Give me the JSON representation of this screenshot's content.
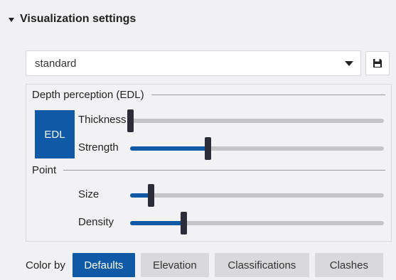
{
  "panel": {
    "title": "Visualization settings"
  },
  "preset": {
    "selected": "standard"
  },
  "edl": {
    "section_title": "Depth perception (EDL)",
    "toggle_label": "EDL",
    "toggle_on": true,
    "thickness": {
      "label": "Thickness",
      "value": 0.0
    },
    "strength": {
      "label": "Strength",
      "value": 0.305
    }
  },
  "point": {
    "section_title": "Point",
    "size": {
      "label": "Size",
      "value": 0.08
    },
    "density": {
      "label": "Density",
      "value": 0.21
    }
  },
  "color_by": {
    "label": "Color by",
    "options": [
      "Defaults",
      "Elevation",
      "Classifications",
      "Clashes"
    ],
    "selected": "Defaults"
  },
  "colors": {
    "accent": "#0e5aa7",
    "thumb": "#2d2d3a",
    "track": "#c5c5c8"
  }
}
